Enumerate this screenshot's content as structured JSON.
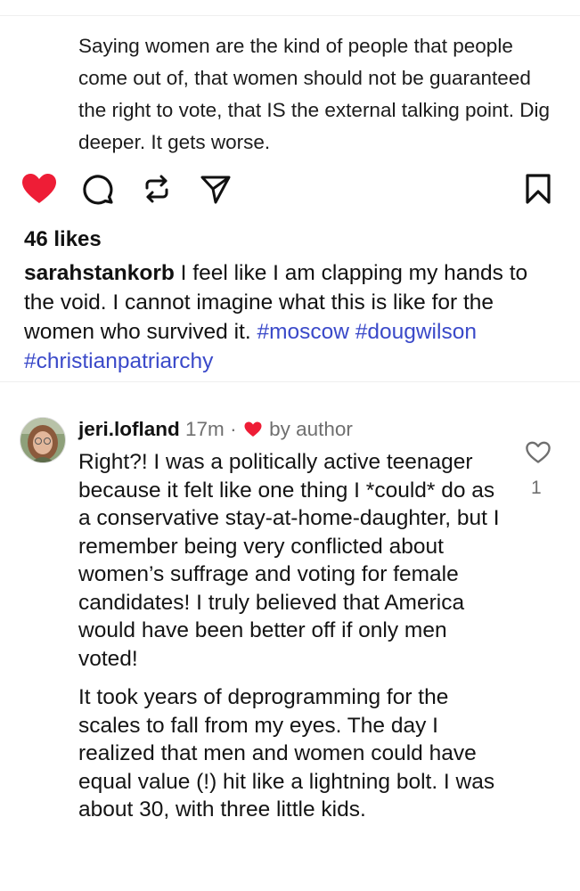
{
  "post": {
    "slide_text": "Saying women are the kind of people that people come out of, that women should not be guaranteed the right to vote, that IS the external talking point. Dig deeper. It gets worse.",
    "likes": "46 likes",
    "caption": {
      "username": "sarahstankorb",
      "text": " I feel like I am clapping my hands to the void. I cannot imagine what this is like for the women who survived it. ",
      "hashtags": [
        "#moscow",
        "#dougwilson",
        "#christianpatriarchy"
      ]
    }
  },
  "actions": {
    "like_icon": "heart-filled-icon",
    "comment_icon": "comment-bubble-icon",
    "repost_icon": "repost-icon",
    "share_icon": "send-icon",
    "save_icon": "bookmark-icon",
    "like_color": "#ee1d36"
  },
  "comment": {
    "username": "jeri.lofland",
    "time": "17m",
    "separator": "·",
    "by_author": "by author",
    "paragraphs": [
      "Right?! I was a politically active teenager because it felt like one thing I *could* do as a conservative stay-at-home-daughter, but I remember being very conflicted about women’s suffrage and voting for female candidates! I truly believed that America would have been better off if only men voted!",
      "It took years of deprogramming for the scales to fall from my eyes. The day I realized that men and women could have equal value (!) hit like a lightning bolt. I was about 30, with three little kids."
    ],
    "like_count": "1"
  }
}
